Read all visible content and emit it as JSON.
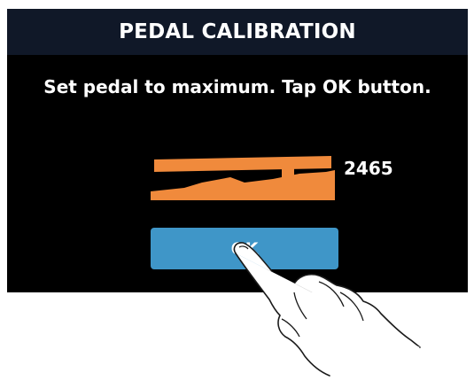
{
  "header": {
    "title": "PEDAL CALIBRATION"
  },
  "instruction": "Set pedal to maximum. Tap OK button.",
  "pedal": {
    "value": "2465",
    "color": "#f08a3c"
  },
  "ok_button": {
    "label": "OK",
    "color": "#3f96c8"
  }
}
